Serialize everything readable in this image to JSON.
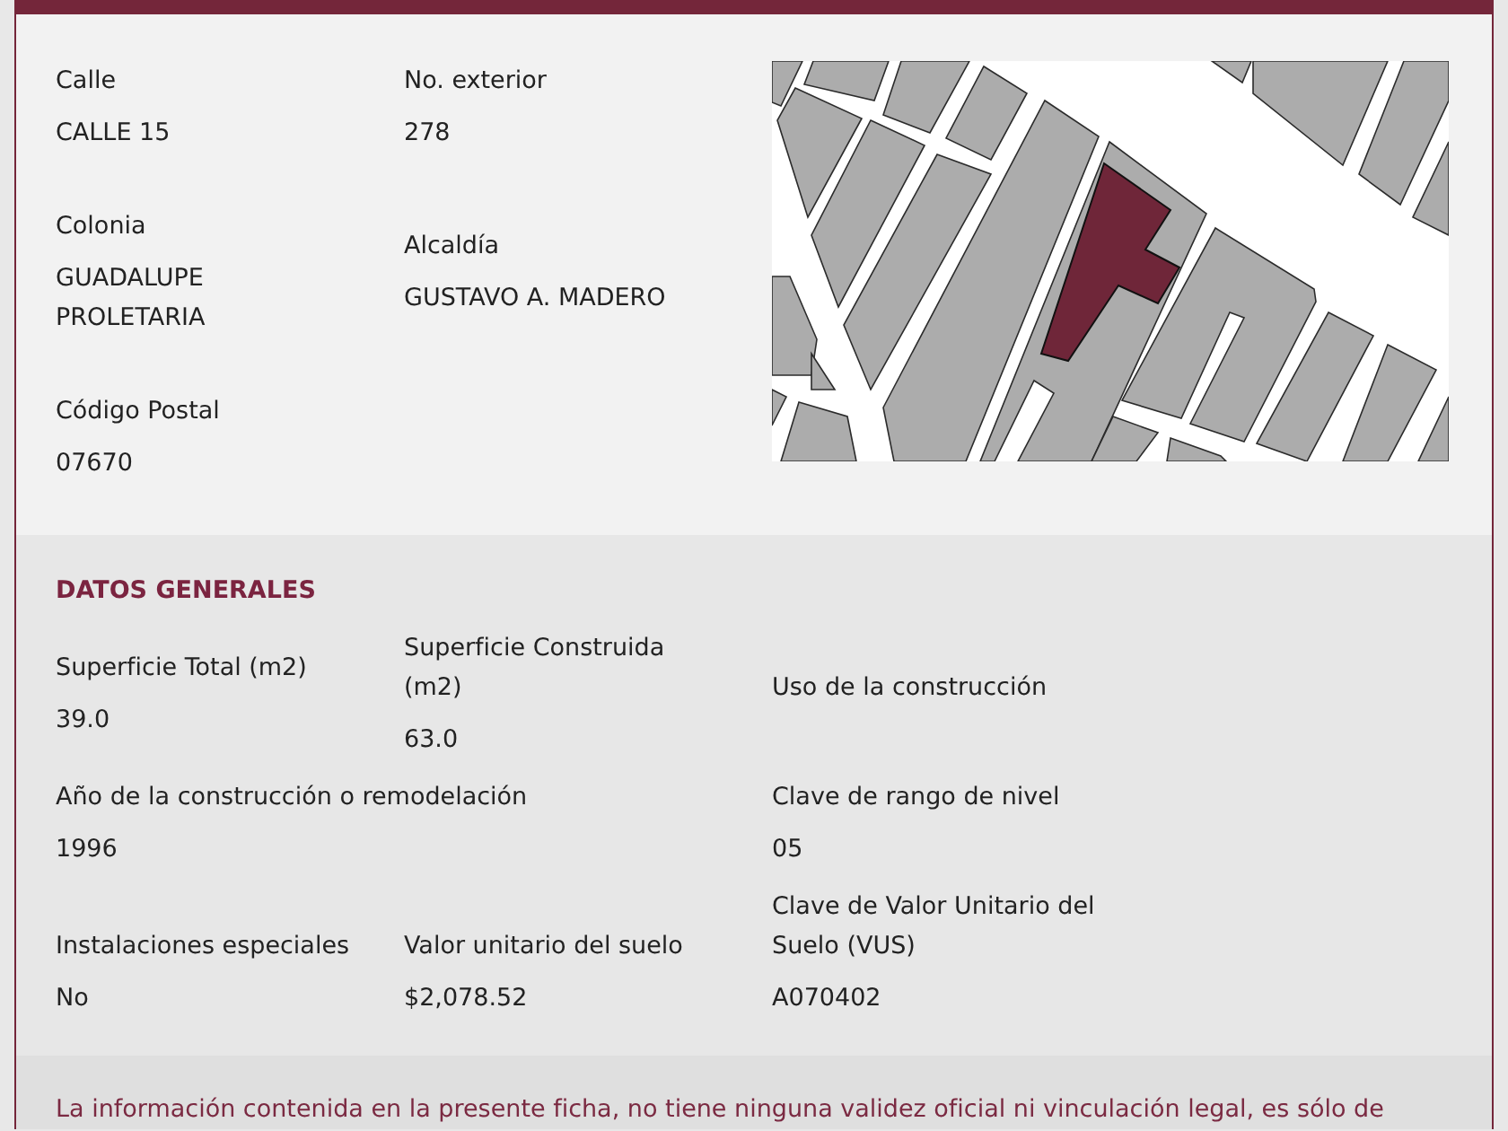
{
  "location": {
    "rows": [
      [
        {
          "label": "Calle",
          "value": "CALLE 15"
        },
        {
          "label": "No. exterior",
          "value": "278"
        }
      ],
      [
        {
          "label": "Colonia",
          "value": "GUADALUPE PROLETARIA"
        },
        {
          "label": "Alcaldía",
          "value": "GUSTAVO A. MADERO"
        }
      ],
      [
        {
          "label": "Código Postal",
          "value": "07670"
        }
      ]
    ]
  },
  "general_data": {
    "title": "DATOS GENERALES",
    "rows": [
      [
        {
          "label": "Superficie Total (m2)",
          "value": "39.0"
        },
        {
          "label": "Superficie Construida (m2)",
          "value": "63.0"
        },
        {
          "label": "Uso de la construcción"
        }
      ],
      [
        {
          "label": "Año de la construcción o remodelación",
          "value": "1996"
        },
        "",
        {
          "label": "Clave de rango de nivel",
          "value": "05"
        }
      ],
      [
        {
          "label": "Instalaciones especiales",
          "value": "No"
        },
        {
          "label": "Valor unitario del suelo",
          "value": "$2,078.52"
        },
        {
          "label": "Clave de Valor Unitario del Suelo (VUS)",
          "value": "A070402"
        }
      ]
    ]
  },
  "disclaimer": "La información contenida en la presente ficha, no tiene ninguna validez oficial ni vinculación legal, es sólo de"
}
